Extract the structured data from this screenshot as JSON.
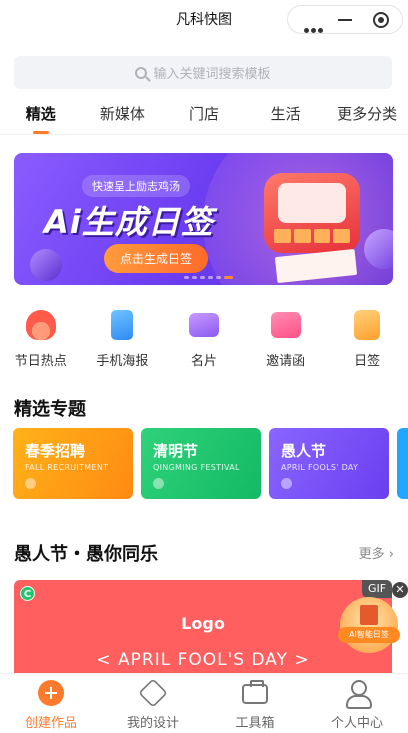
{
  "app": {
    "title": "凡科快图"
  },
  "search": {
    "placeholder": "输入关键词搜索模板"
  },
  "tabs": [
    {
      "label": "精选",
      "active": true
    },
    {
      "label": "新媒体",
      "active": false
    },
    {
      "label": "门店",
      "active": false
    },
    {
      "label": "生活",
      "active": false
    },
    {
      "label": "更多分类",
      "active": false
    }
  ],
  "banner": {
    "chip": "快速呈上励志鸡汤",
    "headline": "Ai生成日签",
    "cta": "点击生成日签",
    "slide_count": 6,
    "active_slide": 5
  },
  "categories": [
    {
      "label": "节日热点",
      "icon": "fire-icon"
    },
    {
      "label": "手机海报",
      "icon": "phone-icon"
    },
    {
      "label": "名片",
      "icon": "card-icon"
    },
    {
      "label": "邀请函",
      "icon": "envelope-icon"
    },
    {
      "label": "日签",
      "icon": "note-icon"
    }
  ],
  "featured": {
    "title": "精选专题",
    "topics": [
      {
        "name": "春季招聘",
        "sub": "FALL RECRUITMENT"
      },
      {
        "name": "清明节",
        "sub": "QINGMING FESTIVAL"
      },
      {
        "name": "愚人节",
        "sub": "APRIL FOOLS' DAY"
      }
    ]
  },
  "section2": {
    "title": "愚人节・愚你同乐",
    "more": "更多 ›",
    "card": {
      "logo": "Logo",
      "caption": "< APRIL FOOL'S DAY >",
      "badge": "C",
      "gif": "GIF"
    }
  },
  "floating": {
    "close": "✕",
    "label": "AI智能日签"
  },
  "bottom_nav": [
    {
      "label": "创建作品",
      "active": true
    },
    {
      "label": "我的设计",
      "active": false
    },
    {
      "label": "工具箱",
      "active": false
    },
    {
      "label": "个人中心",
      "active": false
    }
  ],
  "colors": {
    "accent": "#ff7a2c",
    "banner": "#6d3ff2",
    "spring": "#ffb219",
    "qingming": "#2fd27a",
    "fools": "#8a65ff",
    "holiday": "#ff5f5f"
  }
}
